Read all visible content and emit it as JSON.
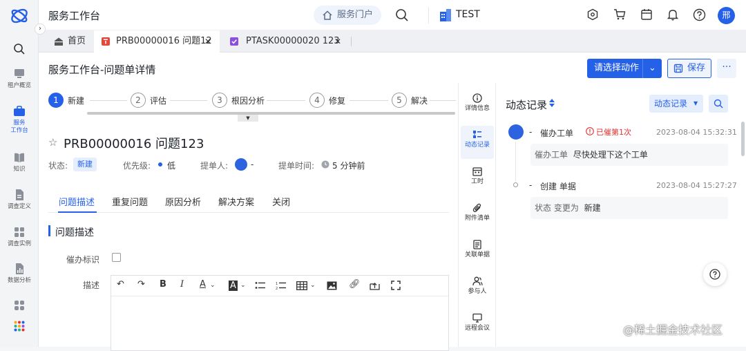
{
  "nav": {
    "items": [
      {
        "label": "租户概览",
        "icon": "monitor-icon"
      },
      {
        "label": "服务\n工作台",
        "icon": "briefcase-icon"
      },
      {
        "label": "知识",
        "icon": "book-icon"
      },
      {
        "label": "调查定义",
        "icon": "survey-doc-icon"
      },
      {
        "label": "调查实例",
        "icon": "grid-icon"
      },
      {
        "label": "数据分析",
        "icon": "chart-doc-icon"
      }
    ],
    "accent": "#2560e8"
  },
  "topbar": {
    "title": "服务工作台",
    "portal_label": "服务门户",
    "tenant_label": "TEST",
    "avatar_text": "邢"
  },
  "tabs": [
    {
      "label": "首页",
      "icon": "home-icon"
    },
    {
      "label": "PRB00000016 问题12",
      "icon": "problem-icon"
    },
    {
      "label": "PTASK00000020 123",
      "icon": "task-check-icon"
    }
  ],
  "page": {
    "title": "服务工作台-问题单详情",
    "action_label": "请选择动作",
    "save_label": "保存",
    "more_label": "···"
  },
  "steps": [
    {
      "num": "1",
      "label": "新建"
    },
    {
      "num": "2",
      "label": "评估"
    },
    {
      "num": "3",
      "label": "根因分析"
    },
    {
      "num": "4",
      "label": "修复"
    },
    {
      "num": "5",
      "label": "解决"
    }
  ],
  "ticket": {
    "title": "PRB00000016  问题123",
    "status_label": "状态:",
    "status_value": "新建",
    "priority_label": "优先级:",
    "priority_value": "低",
    "submitter_label": "提单人:",
    "submitter_value": "-",
    "submit_time_label": "提单时间:",
    "submit_time_value": "5 分钟前"
  },
  "subtabs": [
    "问题描述",
    "重复问题",
    "原因分析",
    "解决方案",
    "关闭"
  ],
  "section": {
    "title": "问题描述",
    "urge_label": "催办标识",
    "desc_label": "描述"
  },
  "rail": [
    {
      "label": "详情信息",
      "icon": "info-icon"
    },
    {
      "label": "动态记录",
      "icon": "activity-icon"
    },
    {
      "label": "工时",
      "icon": "calendar-icon"
    },
    {
      "label": "附件清单",
      "icon": "paperclip-icon"
    },
    {
      "label": "关联单据",
      "icon": "document-icon"
    },
    {
      "label": "参与人",
      "icon": "people-icon"
    },
    {
      "label": "远程会议",
      "icon": "monitor-icon"
    }
  ],
  "activity": {
    "title": "动态记录",
    "dropdown_label": "动态记录",
    "records": [
      {
        "dash": "-",
        "action": "催办工单",
        "badge": "已催第1次",
        "time": "2023-08-04 15:32:31",
        "detail_key": "催办工单",
        "detail_value": "尽快处理下这个工单"
      },
      {
        "dash": "-",
        "action": "创建 单据",
        "time": "2023-08-04 15:27:27",
        "detail_key": "状态 变更为",
        "detail_value": "新建"
      }
    ]
  },
  "watermark": "@稀土掘金技术社区"
}
